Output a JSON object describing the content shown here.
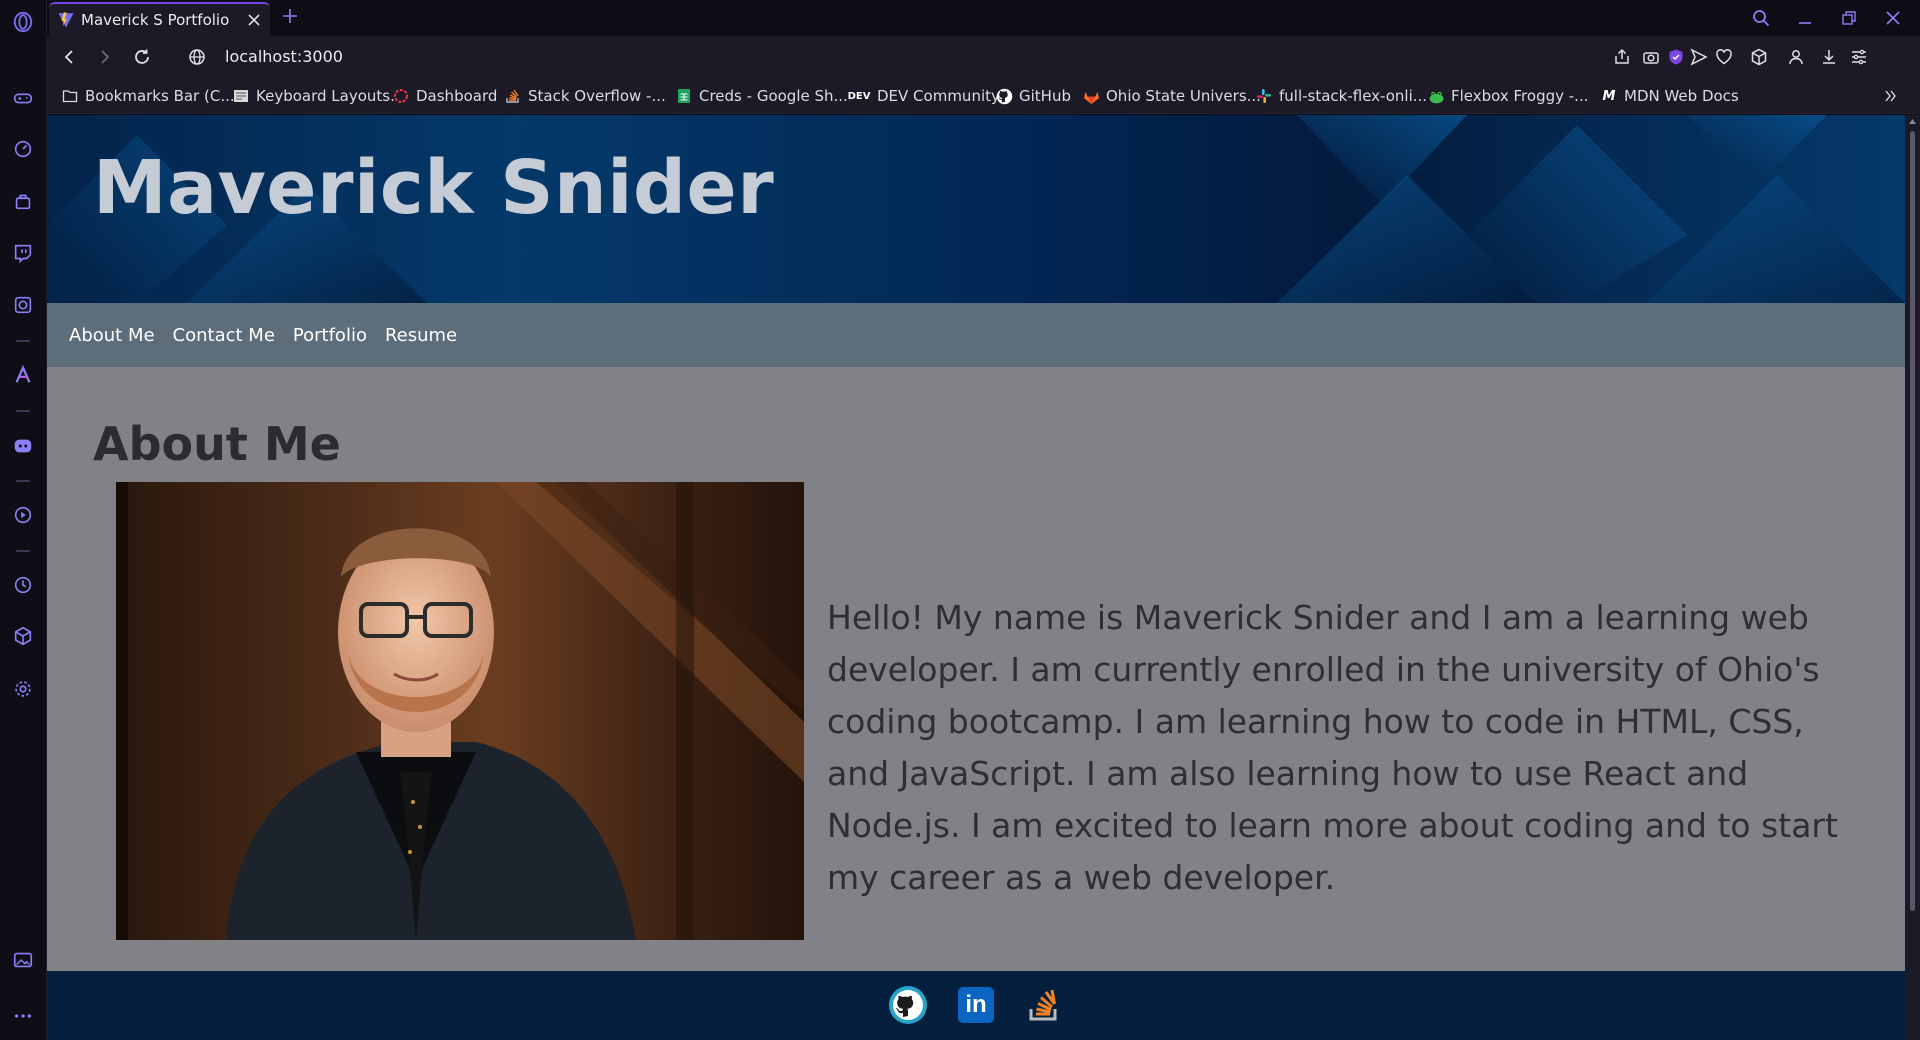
{
  "browser": {
    "tab": {
      "title": "Maverick S Portfolio"
    },
    "url": "localhost:3000",
    "bookmarks": [
      {
        "label": "Bookmarks Bar (C...",
        "icon": "folder-icon"
      },
      {
        "label": "Keyboard Layouts.",
        "icon": "keyboard-icon"
      },
      {
        "label": "Dashboard",
        "icon": "dashboard-icon"
      },
      {
        "label": "Stack Overflow -...",
        "icon": "stackoverflow-icon"
      },
      {
        "label": "Creds - Google Sh...",
        "icon": "sheets-icon"
      },
      {
        "label": "DEV Community",
        "icon": "dev-icon"
      },
      {
        "label": "GitHub",
        "icon": "github-icon"
      },
      {
        "label": "Ohio State Univers...",
        "icon": "gitlab-icon"
      },
      {
        "label": "full-stack-flex-onli...",
        "icon": "slack-icon"
      },
      {
        "label": "Flexbox Froggy -...",
        "icon": "frog-icon"
      },
      {
        "label": "MDN Web Docs",
        "icon": "mdn-icon"
      }
    ],
    "dev_badge": "DEV",
    "mdn_badge": "M"
  },
  "site": {
    "hero_title": "Maverick Snider",
    "nav": [
      "About Me",
      "Contact Me",
      "Portfolio",
      "Resume"
    ],
    "section_title": "About Me",
    "bio": "Hello! My name is Maverick Snider and I am a learning web developer. I am currently enrolled in the university of Ohio's coding bootcamp. I am learning how to code in HTML, CSS, and JavaScript. I am also learning how to use React and Node.js. I am excited to learn more about coding and to start my career as a web developer.",
    "social": [
      {
        "icon": "github-icon"
      },
      {
        "icon": "linkedin-icon",
        "label": "in"
      },
      {
        "icon": "stackoverflow-icon"
      }
    ]
  },
  "colors": {
    "accent": "#7b46e4",
    "hero_bg": "#03234a",
    "navbar_bg": "#5e6d7a",
    "content_bg": "#818188",
    "footer_bg": "#04203e"
  }
}
